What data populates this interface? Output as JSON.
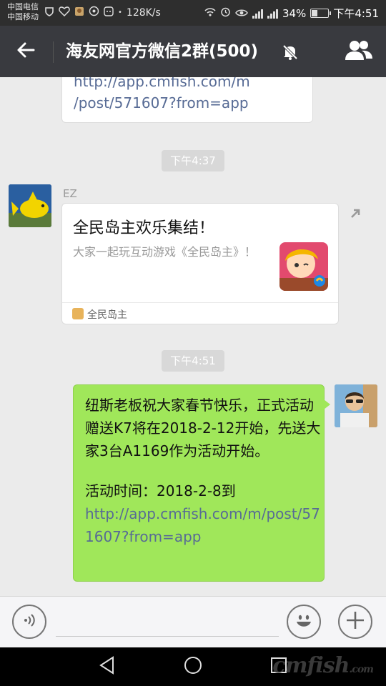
{
  "status_bar": {
    "carrier_1": "中国电信",
    "carrier_2": "中国移动",
    "net_speed": "128K/s",
    "battery": "34%",
    "time": "下午4:51"
  },
  "title_bar": {
    "title": "海友网官方微信2群(500)",
    "icons": [
      "arrow-left-icon",
      "bell-muted-icon",
      "group-members-icon"
    ]
  },
  "messages": {
    "prev_link": {
      "line1": "http://app.cmfish.com/m",
      "line2": "/post/571607?from=app"
    },
    "time_1": "下午4:37",
    "card_msg": {
      "sender": "EZ",
      "title": "全民岛主欢乐集结！",
      "desc": "大家一起玩互动游戏《全民岛主》！",
      "source": "全民岛主"
    },
    "time_2": "下午4:51",
    "my_msg": {
      "body": "纽斯老板祝大家春节快乐，正式活动赠送K7将在2018-2-12开始，先送大家3台A1169作为活动开始。",
      "activity_time": "活动时间：2018-2-8到",
      "link": "http://app.cmfish.com/m/post/571607?from=app"
    }
  },
  "input_bar": {
    "input_value": "",
    "icons": [
      "voice-icon",
      "emoji-icon",
      "plus-icon"
    ]
  },
  "nav_bar": {
    "icons": [
      "back-triangle-icon",
      "home-circle-icon",
      "recents-square-icon"
    ],
    "watermark": "cmfish",
    "watermark_suffix": ".com"
  },
  "colors": {
    "title_bg": "#393a3f",
    "status_bg": "#2e2e2e",
    "chat_bg": "#ebebeb",
    "my_bubble": "#a0e75a",
    "link": "#576b95"
  }
}
